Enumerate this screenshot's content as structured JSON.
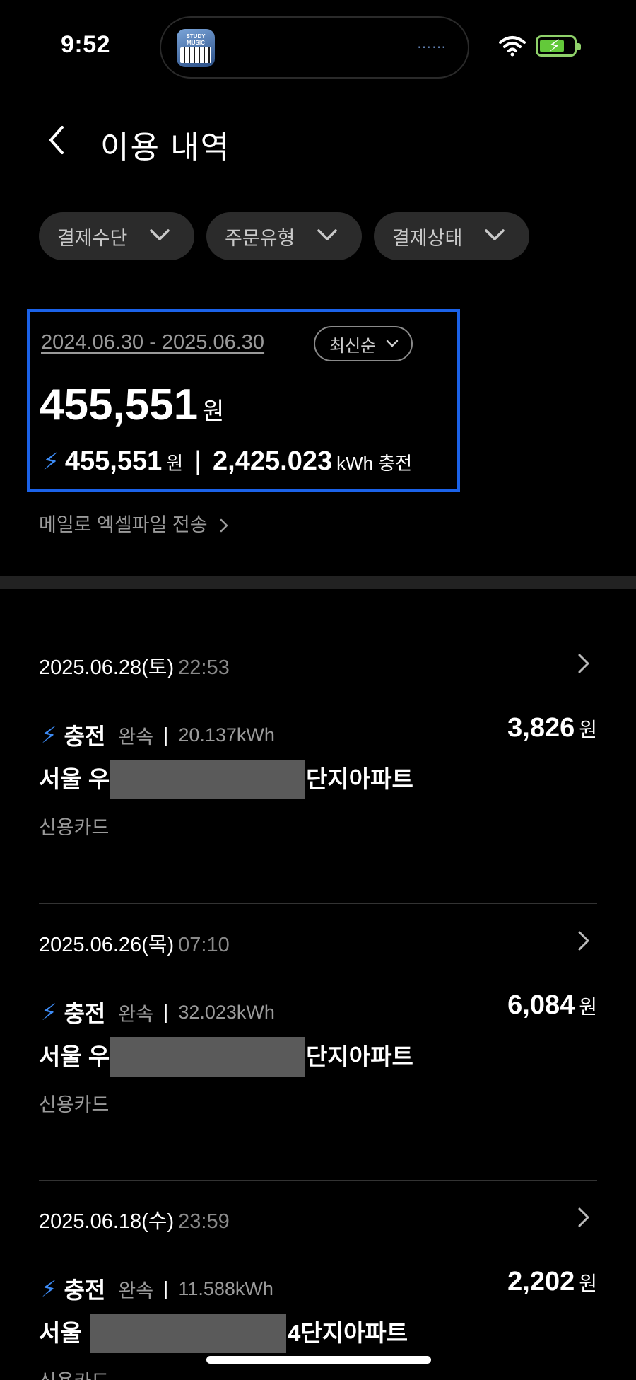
{
  "status_bar": {
    "time": "9:52",
    "app_label": "STUDY MUSIC"
  },
  "header": {
    "title": "이용 내역"
  },
  "filters": [
    {
      "label": "결제수단"
    },
    {
      "label": "주문유형"
    },
    {
      "label": "결제상태"
    }
  ],
  "summary": {
    "period": "2024.06.30 - 2025.06.30",
    "sort_label": "최신순",
    "total_amount": "455,551",
    "total_unit": "원",
    "charge_amount": "455,551",
    "charge_unit": "원",
    "energy": "2,425.023",
    "energy_unit": "kWh 충전"
  },
  "email_export": "메일로 엑셀파일 전송",
  "records": [
    {
      "date": "2025.06.28(토)",
      "time": "22:53",
      "type": "충전",
      "speed": "완속",
      "kwh": "20.137kWh",
      "amount": "3,826",
      "unit": "원",
      "station_prefix": "서울 우",
      "station_suffix": "단지아파트",
      "payment": "신용카드"
    },
    {
      "date": "2025.06.26(목)",
      "time": "07:10",
      "type": "충전",
      "speed": "완속",
      "kwh": "32.023kWh",
      "amount": "6,084",
      "unit": "원",
      "station_prefix": "서울 우",
      "station_suffix": "단지아파트",
      "payment": "신용카드"
    },
    {
      "date": "2025.06.18(수)",
      "time": "23:59",
      "type": "충전",
      "speed": "완속",
      "kwh": "11.588kWh",
      "amount": "2,202",
      "unit": "원",
      "station_prefix": "서울",
      "station_suffix": "4단지아파트",
      "payment": "신용카드"
    }
  ],
  "colors": {
    "accent_blue": "#3d8bf5",
    "highlight_border": "#1b62e8",
    "battery_green": "#63c93a"
  }
}
